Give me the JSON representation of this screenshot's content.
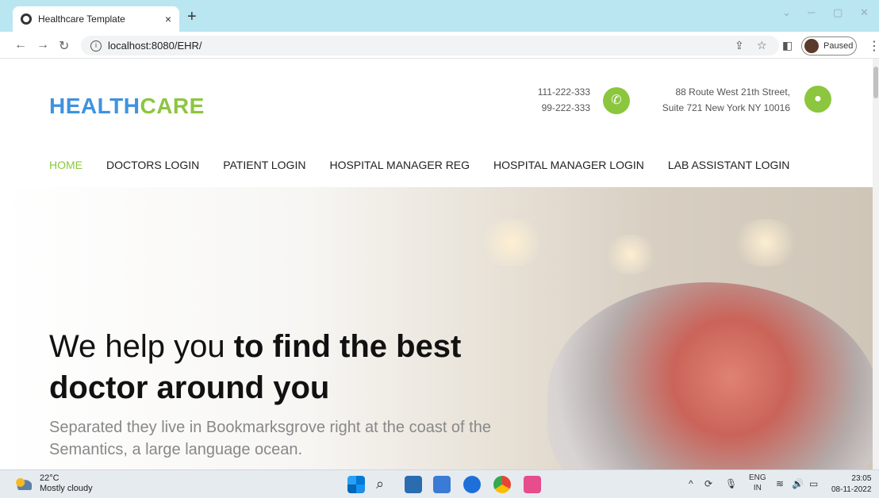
{
  "browser": {
    "tab_title": "Healthcare Template",
    "tab_close": "×",
    "new_tab": "+",
    "url": "localhost:8080/EHR/",
    "profile_status": "Paused"
  },
  "site": {
    "logo_part1": "HEALTH",
    "logo_part2": "CARE",
    "phone1": "111-222-333",
    "phone2": "99-222-333",
    "address1": "88 Route West 21th Street,",
    "address2": "Suite 721 New York NY 10016",
    "accent_color": "#8cc63f",
    "brand_color": "#3f92e0"
  },
  "nav": {
    "items": [
      {
        "label": "HOME",
        "active": true
      },
      {
        "label": "DOCTORS LOGIN"
      },
      {
        "label": "PATIENT LOGIN"
      },
      {
        "label": "HOSPITAL MANAGER REG"
      },
      {
        "label": "HOSPITAL MANAGER LOGIN"
      },
      {
        "label": "LAB ASSISTANT LOGIN"
      }
    ]
  },
  "hero": {
    "line1_normal": "We help you ",
    "line1_bold": "to find the best",
    "line2": "doctor around you",
    "paragraph": "Separated they live in Bookmarksgrove right at the coast of the Semantics, a large language ocean."
  },
  "taskbar": {
    "temperature": "22°C",
    "weather": "Mostly cloudy",
    "lang1": "ENG",
    "lang2": "IN",
    "time": "23:05",
    "date": "08-11-2022"
  }
}
